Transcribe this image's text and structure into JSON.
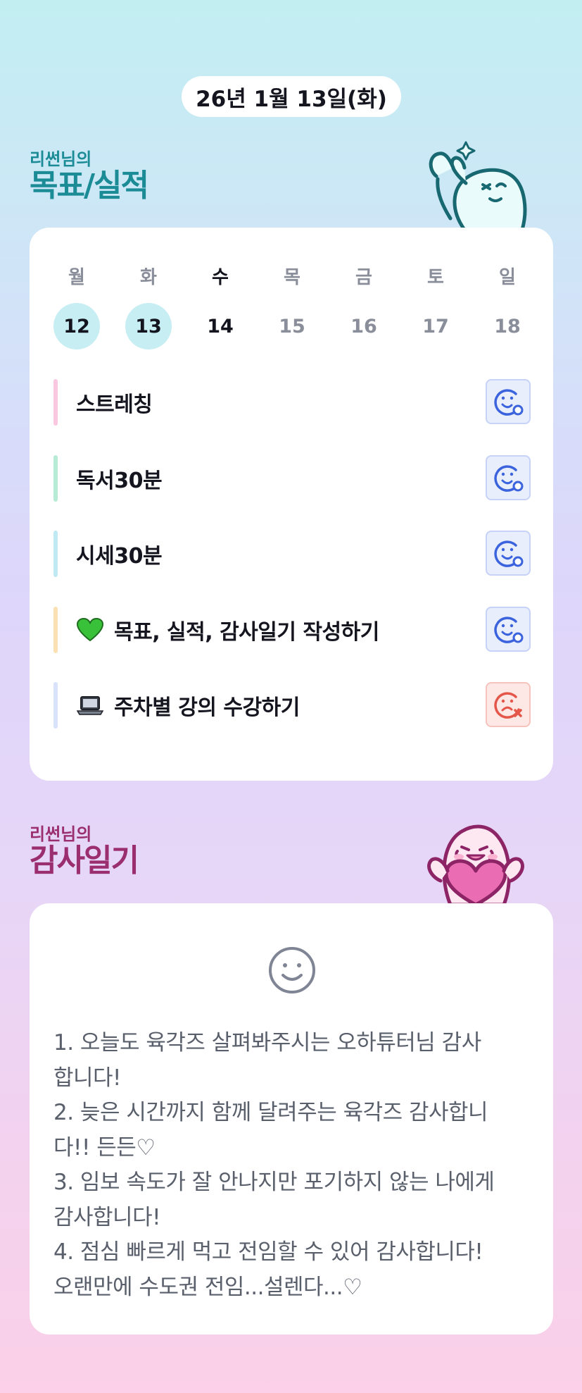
{
  "header": {
    "date": "26년 1월 13일(화)"
  },
  "goals_section": {
    "subtitle": "리썬님의",
    "title": "목표/실적"
  },
  "week": {
    "days": [
      "월",
      "화",
      "수",
      "목",
      "금",
      "토",
      "일"
    ],
    "dates": [
      "12",
      "13",
      "14",
      "15",
      "16",
      "17",
      "18"
    ]
  },
  "tasks": [
    {
      "label": "스트레칭",
      "bar_color": "#f9c7df",
      "status": "done"
    },
    {
      "label": "독서30분",
      "bar_color": "#b8ebd6",
      "status": "done"
    },
    {
      "label": "시세30분",
      "bar_color": "#bfe9f3",
      "status": "done"
    },
    {
      "label": "목표, 실적, 감사일기 작성하기",
      "bar_color": "#fbe0b4",
      "status": "done",
      "emoji": "green-heart-icon"
    },
    {
      "label": "주차별 강의 수강하기",
      "bar_color": "#d8e2fb",
      "status": "failed",
      "emoji": "laptop-icon"
    }
  ],
  "diary_section": {
    "subtitle": "리썬님의",
    "title": "감사일기"
  },
  "diary": {
    "mood_icon": "smile-icon",
    "lines": [
      "1. 오늘도 육각즈 살펴봐주시는 오하튜터님 감사",
      "합니다!",
      "2. 늦은 시간까지 함께 달려주는 육각즈 감사합니",
      "다!! 든든♡",
      "3. 임보 속도가 잘 안나지만 포기하지 않는 나에게",
      "감사합니다!",
      "4. 점심 빠르게 먹고 전임할 수 있어 감사합니다!",
      "오랜만에 수도권 전임...설렌다...♡"
    ]
  },
  "colors": {
    "teal_title": "#1b8b96",
    "magenta_title": "#9b2e6f",
    "done_date_bg": "#c6eef3",
    "ok_icon": "#3a63dd",
    "fail_icon": "#e4564a"
  }
}
